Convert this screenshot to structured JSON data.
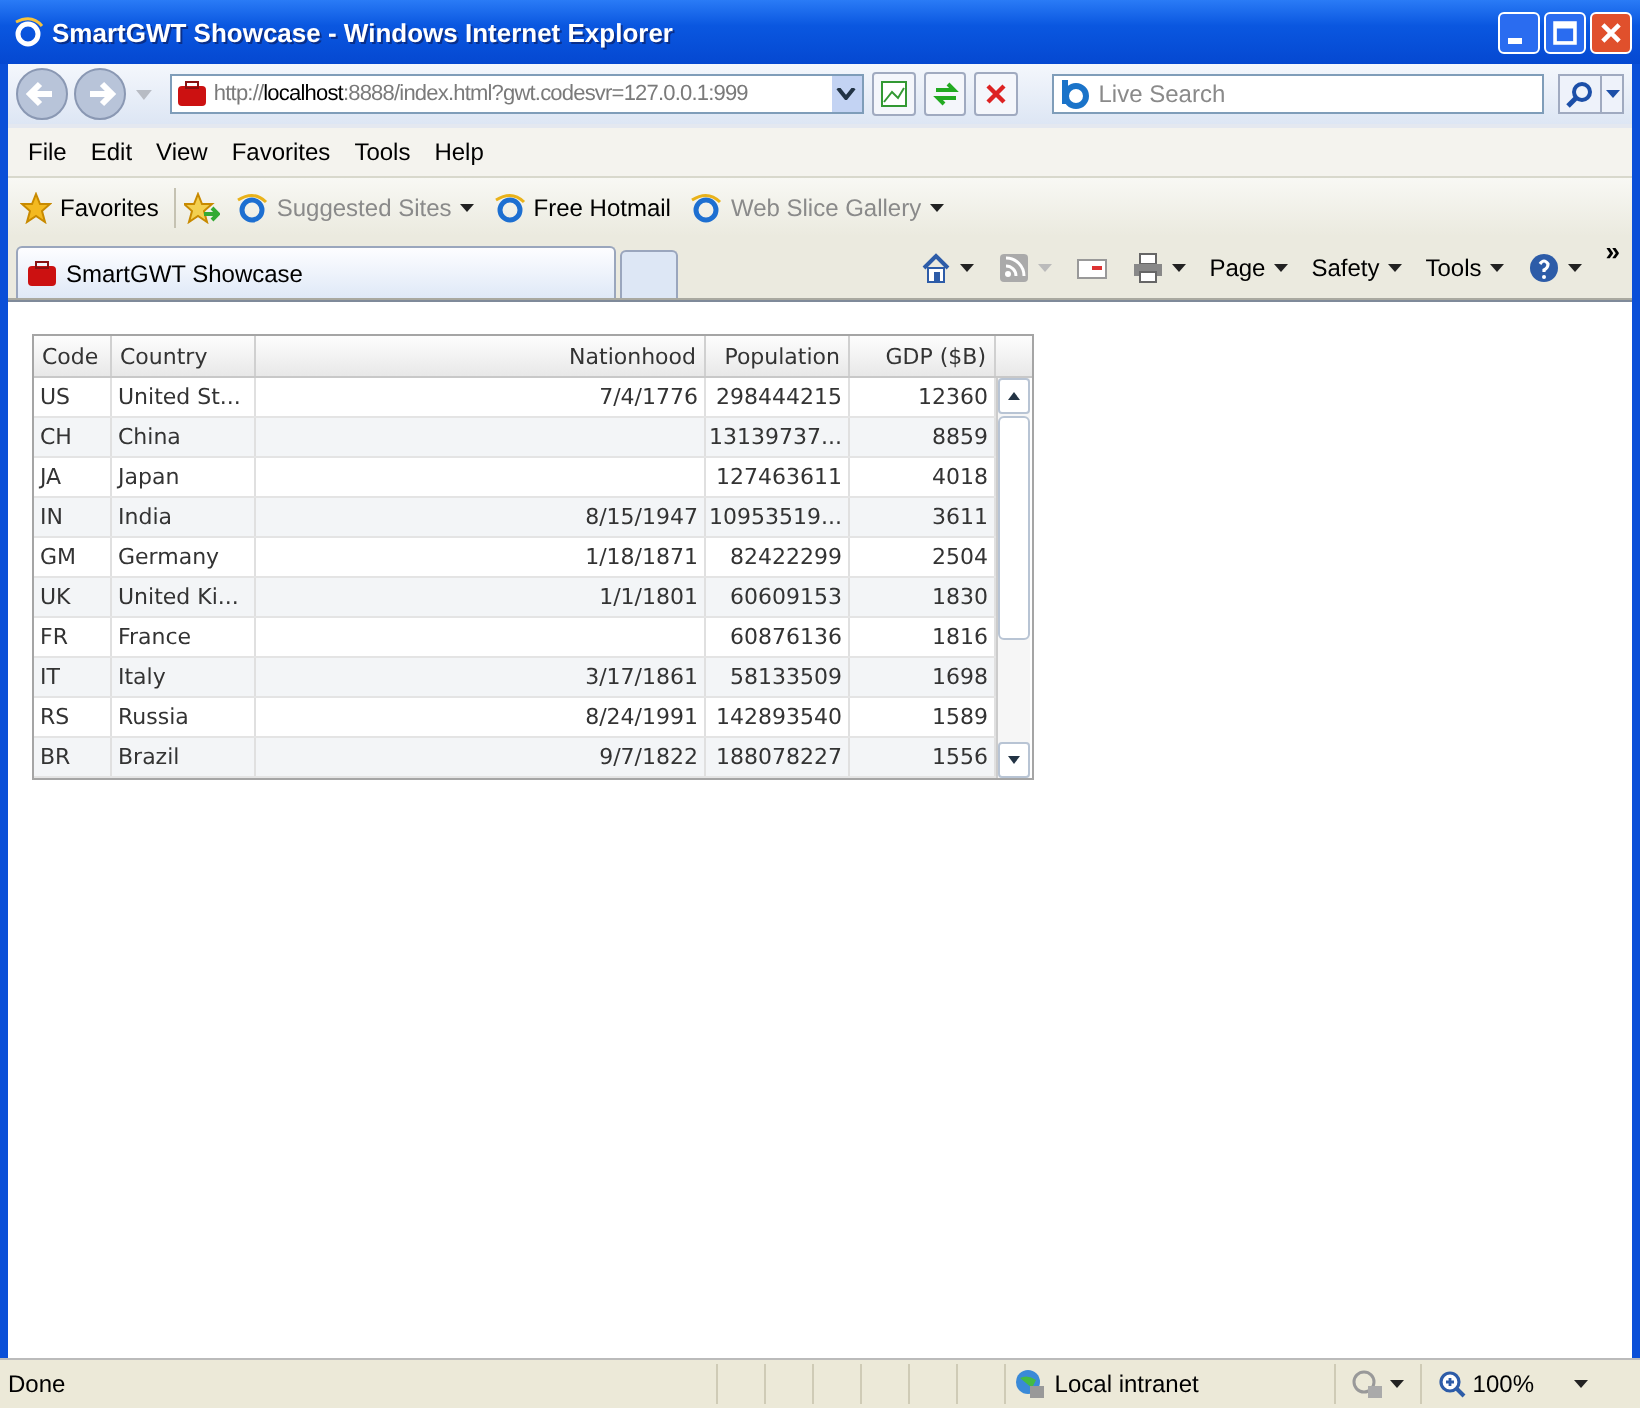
{
  "window": {
    "title": "SmartGWT Showcase - Windows Internet Explorer"
  },
  "address": {
    "scheme": "http://",
    "host": "localhost",
    "rest": ":8888/index.html?gwt.codesvr=127.0.0.1:999"
  },
  "search": {
    "placeholder": "Live Search"
  },
  "menu": [
    "File",
    "Edit",
    "View",
    "Favorites",
    "Tools",
    "Help"
  ],
  "favorites_bar": [
    {
      "label": "Favorites",
      "kind": "star",
      "disabled": false
    },
    {
      "label": "Suggested Sites",
      "kind": "ie-menu",
      "disabled": true
    },
    {
      "label": "Free Hotmail",
      "kind": "ie",
      "disabled": false
    },
    {
      "label": "Web Slice Gallery",
      "kind": "ie-menu",
      "disabled": true
    }
  ],
  "tabs": [
    {
      "label": "SmartGWT Showcase",
      "selected": true
    }
  ],
  "more_button": "»",
  "command_bar": [
    {
      "kind": "home"
    },
    {
      "kind": "feed"
    },
    {
      "kind": "mail"
    },
    {
      "kind": "print"
    },
    {
      "kind": "text",
      "label": "Page"
    },
    {
      "kind": "text",
      "label": "Safety"
    },
    {
      "kind": "text",
      "label": "Tools"
    },
    {
      "kind": "help"
    }
  ],
  "table": {
    "columns": [
      {
        "label": "Code"
      },
      {
        "label": "Country"
      },
      {
        "label": "Nationhood"
      },
      {
        "label": "Population"
      },
      {
        "label": "GDP ($B)"
      }
    ],
    "rows": [
      [
        "US",
        "United St...",
        "7/4/1776",
        "298444215",
        "12360"
      ],
      [
        "CH",
        "China",
        "",
        "13139737...",
        "8859"
      ],
      [
        "JA",
        "Japan",
        "",
        "127463611",
        "4018"
      ],
      [
        "IN",
        "India",
        "8/15/1947",
        "10953519...",
        "3611"
      ],
      [
        "GM",
        "Germany",
        "1/18/1871",
        "82422299",
        "2504"
      ],
      [
        "UK",
        "United Ki...",
        "1/1/1801",
        "60609153",
        "1830"
      ],
      [
        "FR",
        "France",
        "",
        "60876136",
        "1816"
      ],
      [
        "IT",
        "Italy",
        "3/17/1861",
        "58133509",
        "1698"
      ],
      [
        "RS",
        "Russia",
        "8/24/1991",
        "142893540",
        "1589"
      ],
      [
        "BR",
        "Brazil",
        "9/7/1822",
        "188078227",
        "1556"
      ]
    ]
  },
  "status_bar": {
    "text": "Done",
    "zone": "Local intranet",
    "zoom": "100%"
  }
}
